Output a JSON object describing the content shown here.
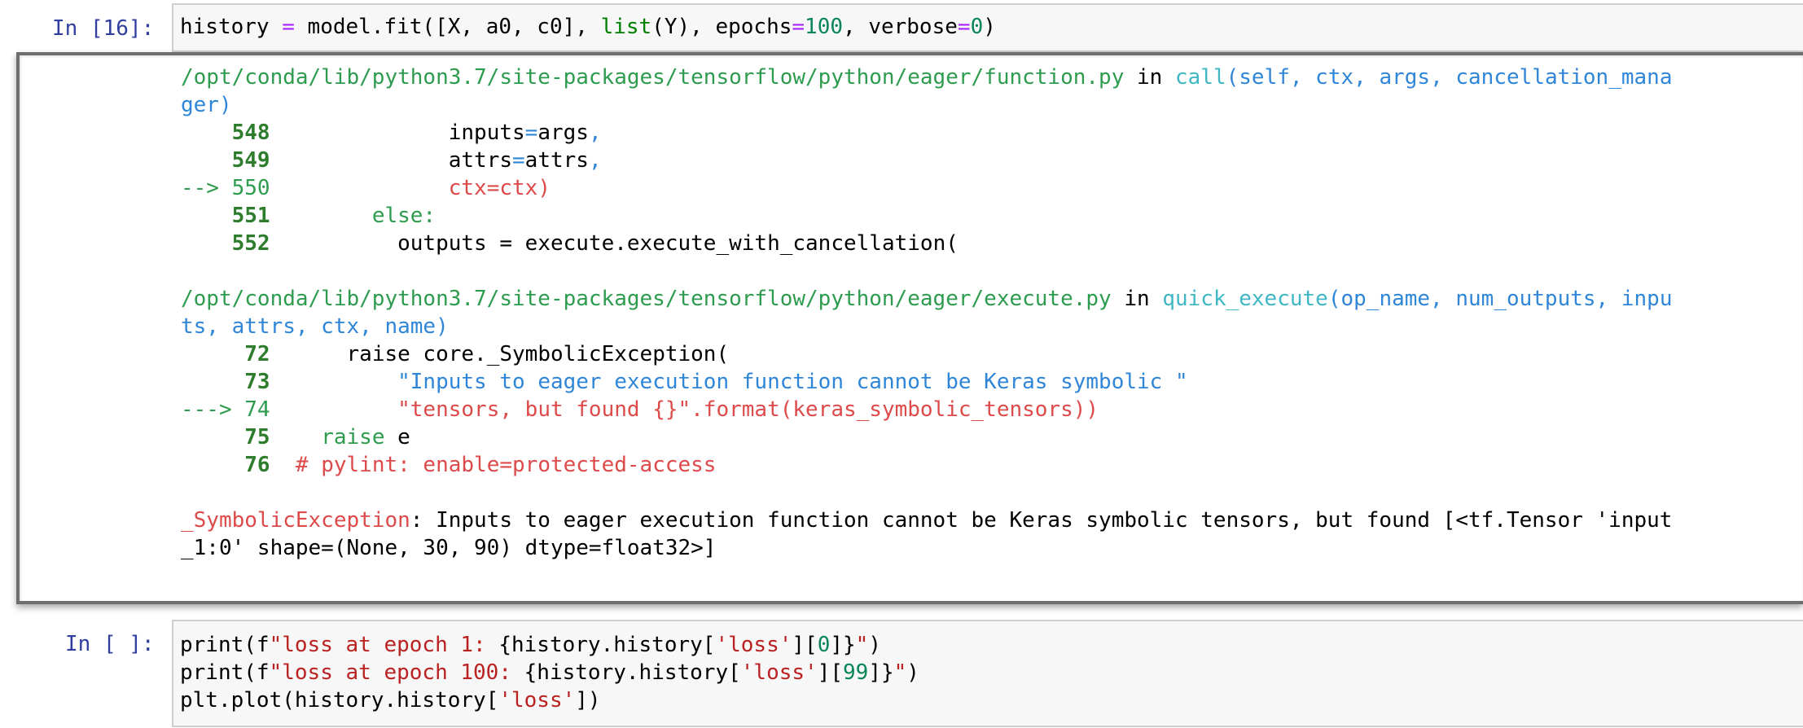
{
  "cell1": {
    "prompt": "In [16]:",
    "code": {
      "a": "history ",
      "eq1": "=",
      "b": " model.fit([X, a0, c0], ",
      "list": "list",
      "c": "(Y), epochs",
      "eq2": "=",
      "n100": "100",
      "d": ", verbose",
      "eq3": "=",
      "n0": "0",
      "e": ")"
    }
  },
  "output": {
    "frame1": {
      "path": "/opt/conda/lib/python3.7/site-packages/tensorflow/python/eager/function.py",
      "in": " in ",
      "func": "call",
      "args_line1": "(self, ctx, args, cancellation_mana",
      "args_line2": "ger)",
      "lines": [
        {
          "prefix": "    ",
          "lno": "548",
          "code_a": "              inputs",
          "eq": "=",
          "code_b": "args",
          "comma": ","
        },
        {
          "prefix": "    ",
          "lno": "549",
          "code_a": "              attrs",
          "eq": "=",
          "code_b": "attrs",
          "comma": ","
        },
        {
          "prefix": "--> ",
          "lno": "550",
          "code": "              ctx=ctx)"
        },
        {
          "prefix": "    ",
          "lno": "551",
          "code": "        else:"
        },
        {
          "prefix": "    ",
          "lno": "552",
          "code": "          outputs = execute.execute_with_cancellation("
        }
      ]
    },
    "frame2": {
      "path": "/opt/conda/lib/python3.7/site-packages/tensorflow/python/eager/execute.py",
      "in": " in ",
      "func": "quick_execute",
      "args_line1": "(op_name, num_outputs, inpu",
      "args_line2": "ts, attrs, ctx, name)",
      "lines": [
        {
          "prefix": "     ",
          "lno": "72",
          "code": "      raise core._SymbolicException("
        },
        {
          "prefix": "     ",
          "lno": "73",
          "code": "          \"Inputs to eager execution function cannot be Keras symbolic \""
        },
        {
          "prefix": "---> ",
          "lno": "74",
          "code": "          \"tensors, but found {}\".format(keras_symbolic_tensors))"
        },
        {
          "prefix": "     ",
          "lno": "75",
          "code_kw": "    raise",
          "code_rest": " e"
        },
        {
          "prefix": "     ",
          "lno": "76",
          "code": "  # pylint: enable=protected-access"
        }
      ]
    },
    "exception": {
      "name": "_SymbolicException",
      "message_line1": ": Inputs to eager execution function cannot be Keras symbolic tensors, but found [<tf.Tensor 'input",
      "message_line2": "_1:0' shape=(None, 30, 90) dtype=float32>]"
    }
  },
  "cell2": {
    "prompt": "In [ ]:",
    "lines": [
      {
        "fn": "print(f",
        "s1": "\"loss at epoch 1: ",
        "mid": "{history.history[",
        "s2": "'loss'",
        "idx_open": "][",
        "n": "0",
        "close": "]}",
        "s3": "\"",
        "end": ")"
      },
      {
        "fn": "print(f",
        "s1": "\"loss at epoch 100: ",
        "mid": "{history.history[",
        "s2": "'loss'",
        "idx_open": "][",
        "n": "99",
        "close": "]}",
        "s3": "\"",
        "end": ")"
      },
      {
        "fn": "plt.plot(history.history[",
        "s2": "'loss'",
        "end": "])"
      }
    ]
  }
}
